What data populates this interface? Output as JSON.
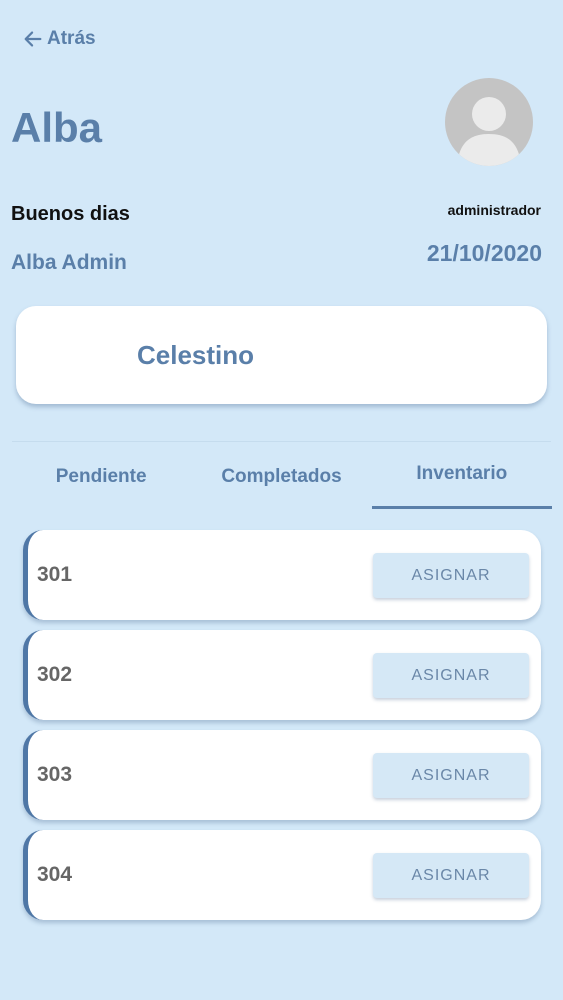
{
  "header": {
    "back_label": "Atrás",
    "title": "Alba"
  },
  "user": {
    "greeting": "Buenos dias",
    "role": "administrador",
    "name": "Alba Admin",
    "date": "21/10/2020"
  },
  "selected": {
    "name": "Celestino"
  },
  "tabs": [
    {
      "label": "Pendiente",
      "active": false
    },
    {
      "label": "Completados",
      "active": false
    },
    {
      "label": "Inventario",
      "active": true
    }
  ],
  "rooms": [
    {
      "number": "301",
      "action": "ASIGNAR"
    },
    {
      "number": "302",
      "action": "ASIGNAR"
    },
    {
      "number": "303",
      "action": "ASIGNAR"
    },
    {
      "number": "304",
      "action": "ASIGNAR"
    }
  ],
  "colors": {
    "background": "#d3e8f8",
    "accent": "#5a7fa9",
    "card": "#ffffff",
    "button": "#d5e8f6"
  }
}
